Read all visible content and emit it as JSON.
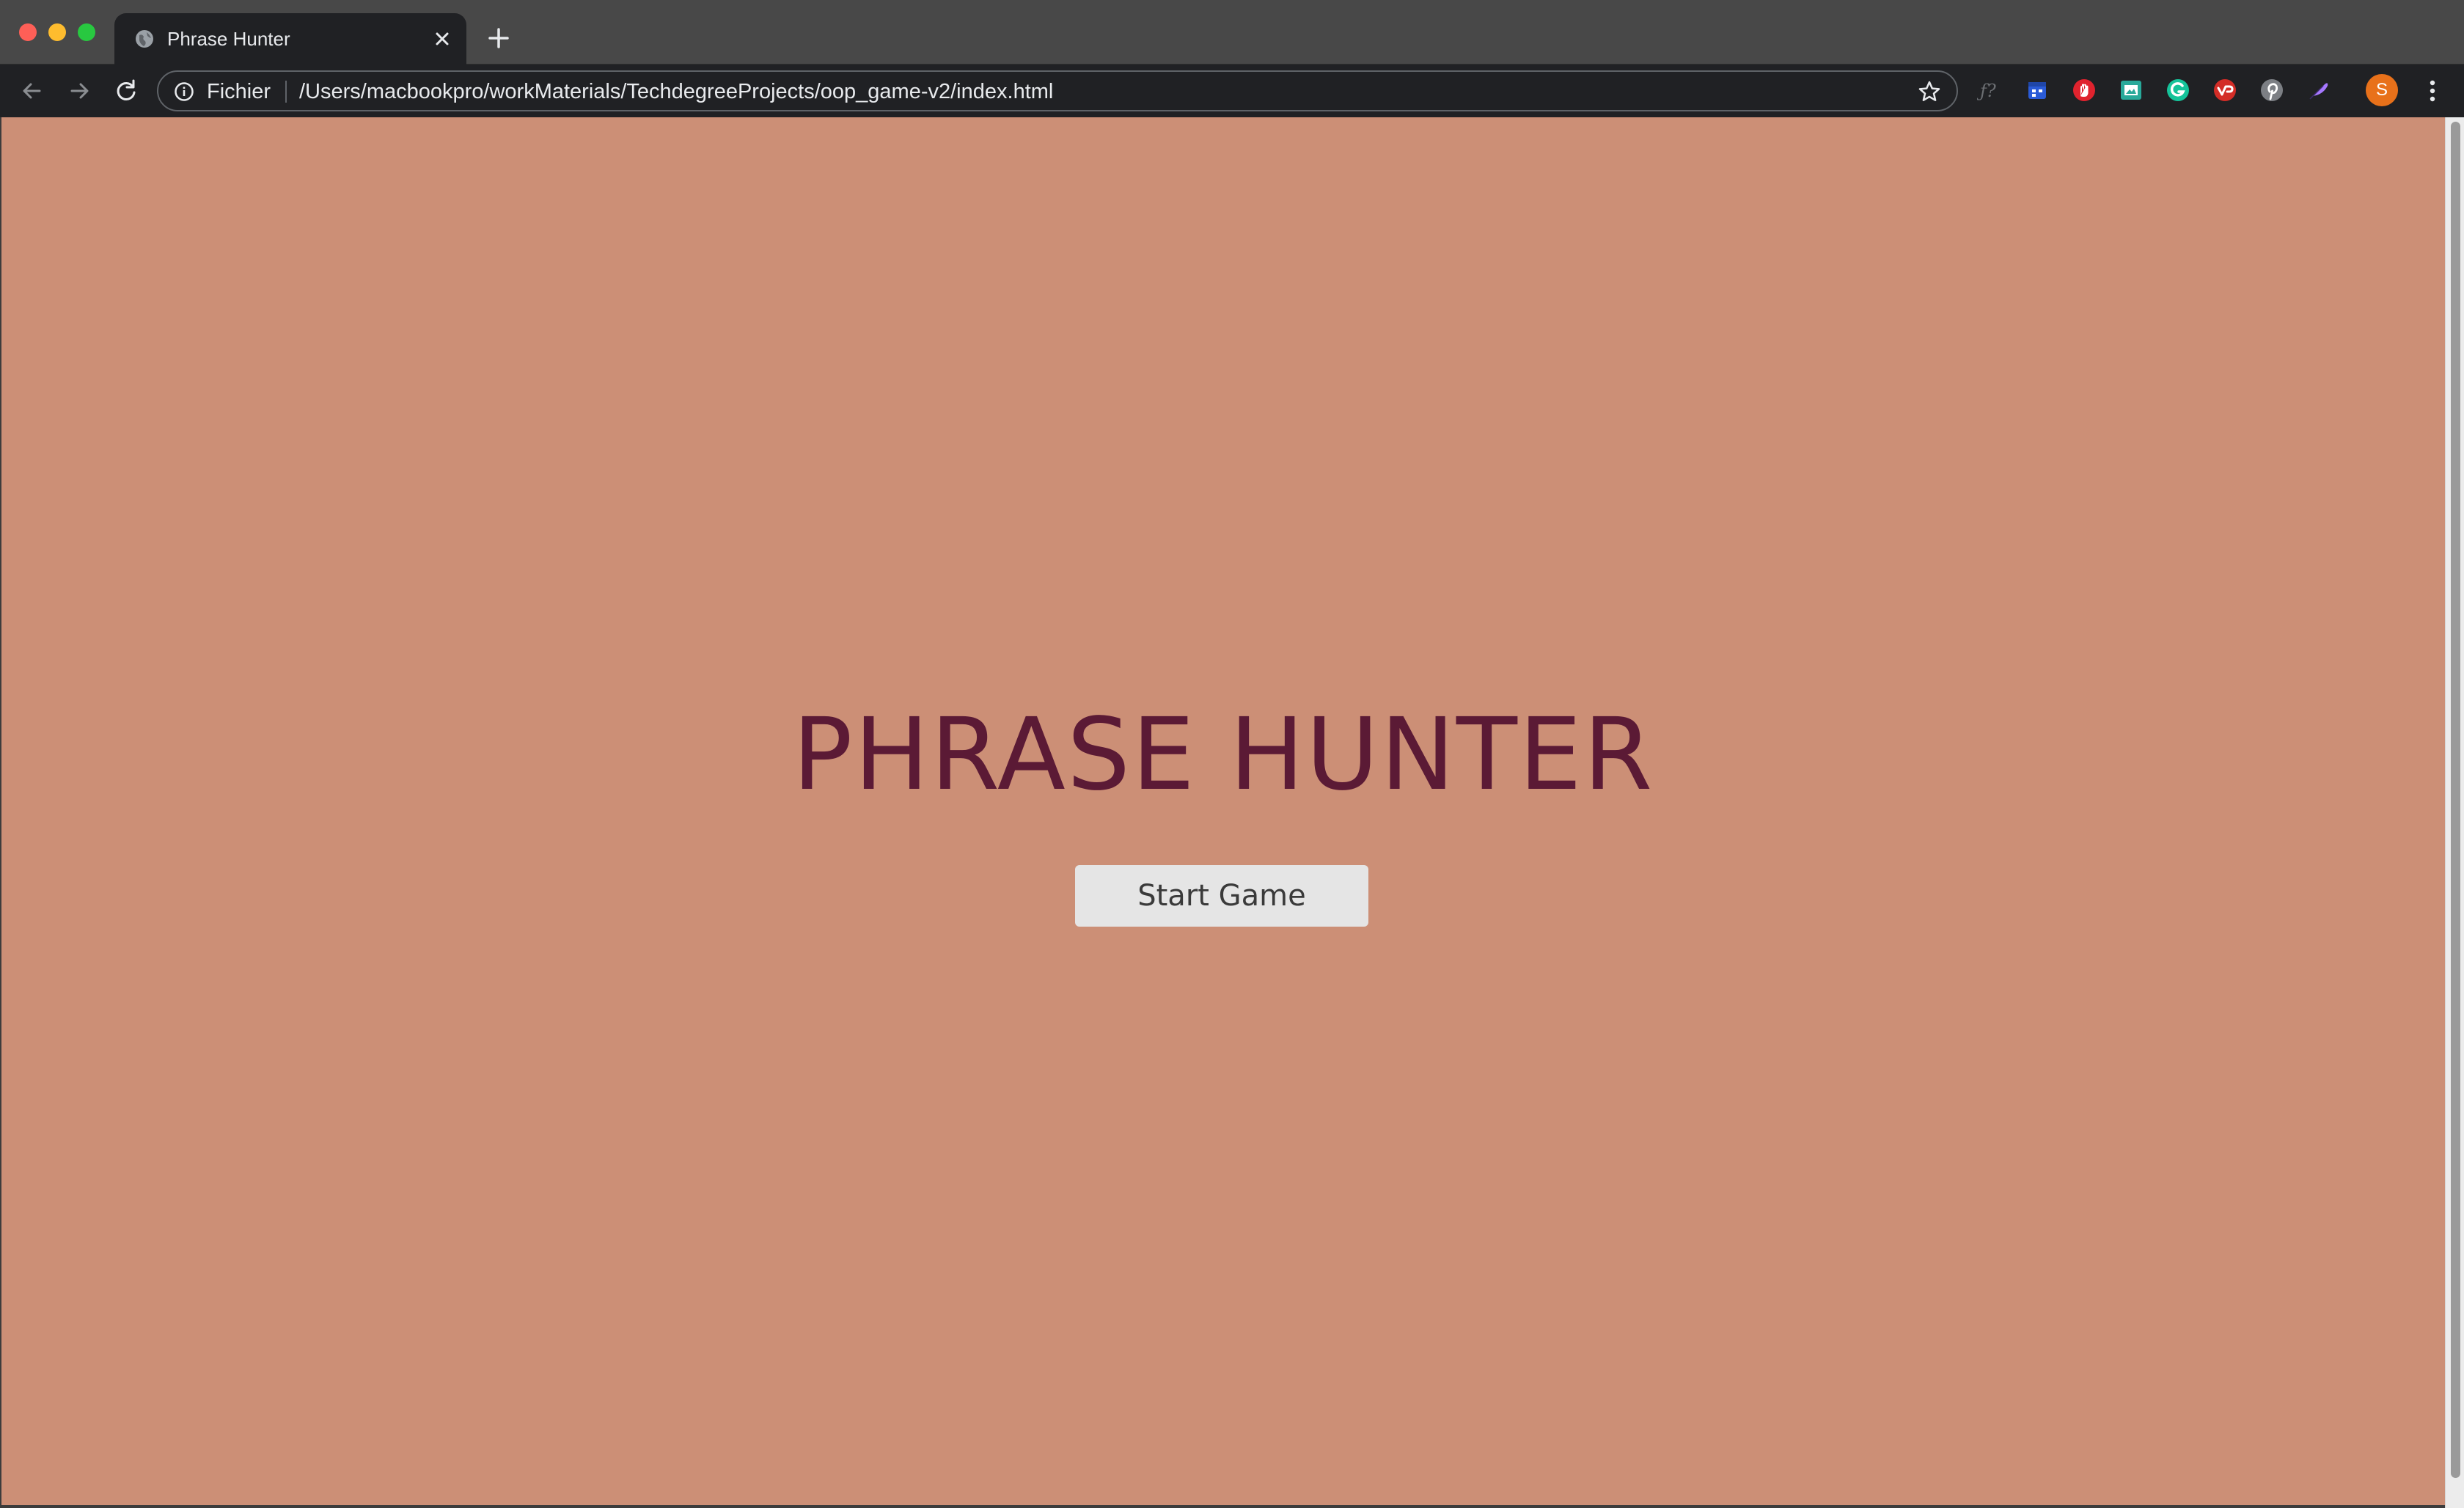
{
  "browser": {
    "tab": {
      "title": "Phrase Hunter"
    },
    "omnibox": {
      "scheme_label": "Fichier",
      "url": "/Users/macbookpro/workMaterials/TechdegreeProjects/oop_game-v2/index.html"
    },
    "profile_initial": "S",
    "extensions": [
      "formula-extension-icon",
      "calendar-extension-icon",
      "adblock-extension-icon",
      "screenshot-extension-icon",
      "grammarly-extension-icon",
      "lastpass-extension-icon",
      "pinterest-extension-icon",
      "feather-extension-icon"
    ]
  },
  "page": {
    "title": "PHRASE HUNTER",
    "start_button_label": "Start Game",
    "colors": {
      "background": "#cc8f76",
      "title": "#5b1a35",
      "button_bg": "#e5e5e5",
      "button_text": "#3a3a3a"
    }
  }
}
